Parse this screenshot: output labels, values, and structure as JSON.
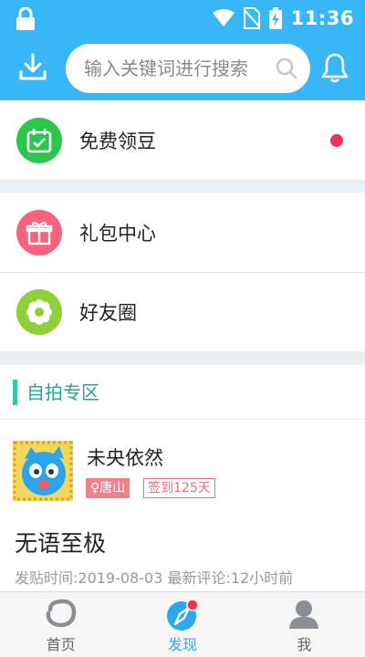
{
  "status_bar": {
    "time": "11:36"
  },
  "header": {
    "search_placeholder": "输入关键词进行搜索"
  },
  "menu": [
    {
      "label": "免费领豆",
      "icon": "calendar-check-icon",
      "color": "#2ec54d",
      "has_dot": true
    },
    {
      "label": "礼包中心",
      "icon": "gift-icon",
      "color": "#f7637f",
      "has_dot": false
    },
    {
      "label": "好友圈",
      "icon": "flower-icon",
      "color": "#8ed036",
      "has_dot": false
    }
  ],
  "selfie_section": {
    "title": "自拍专区",
    "post": {
      "username": "未央依然",
      "location_badge": "♀唐山",
      "signin_badge": "签到125天",
      "title": "无语至极",
      "meta": "发贴时间:2019-08-03  最新评论:12小时前"
    }
  },
  "tabs": [
    {
      "label": "首页",
      "icon": "home-ring-icon",
      "active": false
    },
    {
      "label": "发现",
      "icon": "compass-icon",
      "active": true
    },
    {
      "label": "我",
      "icon": "user-icon",
      "active": false
    }
  ],
  "colors": {
    "accent": "#38b6f5",
    "notification_dot": "#f2305b",
    "section_accent": "#31c9a7"
  }
}
